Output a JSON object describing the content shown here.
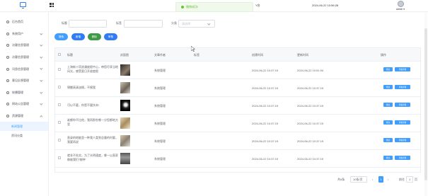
{
  "topbar": {
    "toast": "撤销成功!",
    "fragment": "Y台",
    "datetime": "2024-06-22 10:56:28",
    "username": "admin"
  },
  "sidebar": {
    "items": [
      {
        "label": "后台首页",
        "icon": "home-icon"
      },
      {
        "label": "系统用户",
        "icon": "user-icon"
      },
      {
        "label": "访客信息管理",
        "icon": "users-icon"
      },
      {
        "label": "访客信息管理",
        "icon": "users-icon"
      },
      {
        "label": "讯息信息管理",
        "icon": "message-icon"
      },
      {
        "label": "意见反馈管理",
        "icon": "feedback-icon"
      },
      {
        "label": "轮播管理",
        "icon": "image-icon"
      },
      {
        "label": "网站公告管理",
        "icon": "notice-icon"
      },
      {
        "label": "资源管理",
        "icon": "folder-icon"
      }
    ],
    "subitems": [
      "新闻管理",
      "资讯分类"
    ]
  },
  "search": {
    "title_label": "标题",
    "tag_label": "标签",
    "category_label": "分类",
    "category_placeholder": "请选择"
  },
  "buttons": {
    "search": "搜索",
    "add": "新增",
    "delete": "删除",
    "audit": "审核"
  },
  "table": {
    "columns": [
      "标题",
      "封面图",
      "文章作者",
      "标签",
      "创建时间",
      "更新时间",
      "操作"
    ],
    "rows": [
      {
        "title": "上海新十项浪漫度假中心，带您尽享当地风光，感受夏日开放度假",
        "author": "系统管理",
        "created": "2024-06-22 10:37:19",
        "updated": "2024-06-22 10:51:04"
      },
      {
        "title": "锦鲤高清油锅，不摸我",
        "author": "系统管理",
        "created": "2024-06-22 10:37:19",
        "updated": "2024-06-22 10:37:19"
      },
      {
        "title": "可以不要，你是不要扶本!",
        "author": "系统管理",
        "created": "2024-06-22 10:37:19",
        "updated": "2024-06-22 10:37:19"
      },
      {
        "title": "谁都你不比他，我再那些哪一分您都地方里",
        "author": "系统管理",
        "created": "2024-06-22 10:37:19",
        "updated": "2024-06-22 10:37:19"
      },
      {
        "title": "直录的地能里一种我人类到总督的时要，我要再说",
        "author": "系统管理",
        "created": "2024-06-22 10:37:19",
        "updated": "2024-06-22 10:37:19"
      },
      {
        "title": "就非不失实，为了光明速度，哪一以直家做被我们“物种”",
        "author": "系统管理",
        "created": "2024-06-22 10:37:19",
        "updated": "2024-06-22 10:37:19"
      }
    ],
    "edit_label": "修改",
    "detail_label": "查看详情"
  },
  "pager": {
    "total": "共6条",
    "page_size": "10条/页",
    "current": "1",
    "goto_label": "前往",
    "goto_value": "1",
    "page_suffix": "页"
  },
  "colors": {
    "primary": "#409eff",
    "success": "#67c23a",
    "danger": "#f56c6c",
    "info": "#909399"
  }
}
